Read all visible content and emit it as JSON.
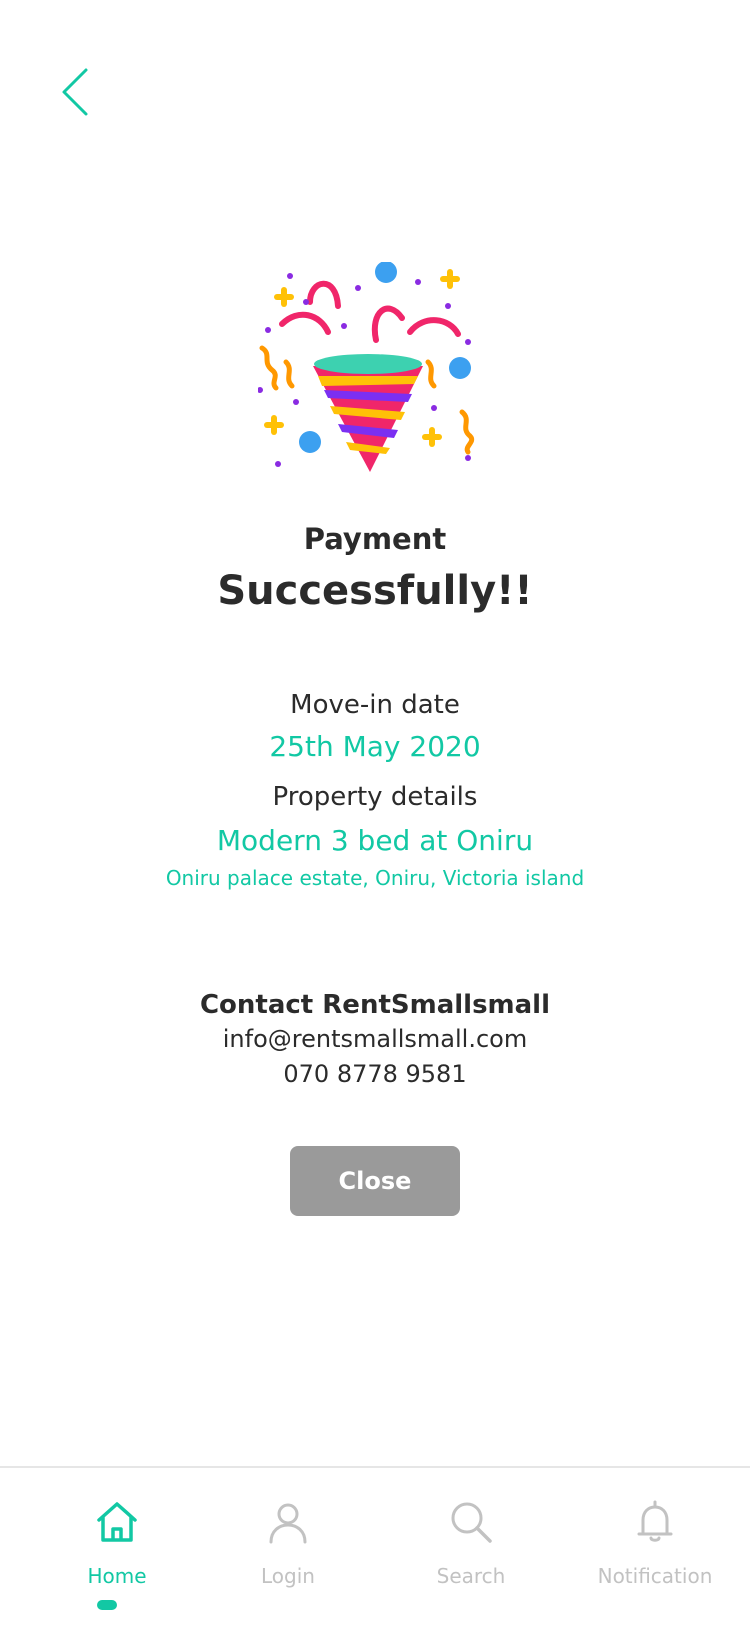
{
  "colors": {
    "accent": "#12c8a4",
    "text": "#2b2b2b",
    "button_bg": "#9a9a9a",
    "nav_inactive": "#c2c2c2"
  },
  "header": {
    "back_icon": "chevron-left-icon"
  },
  "illustration": {
    "icon": "party-popper-icon"
  },
  "status": {
    "line1": "Payment",
    "line2": "Successfully!!"
  },
  "move_in": {
    "label": "Move-in date",
    "value": "25th May 2020"
  },
  "property": {
    "label": "Property details",
    "name": "Modern 3 bed at Oniru",
    "address": "Oniru palace estate, Oniru, Victoria island"
  },
  "contact": {
    "title": "Contact RentSmallsmall",
    "email": "info@rentsmallsmall.com",
    "phone": "070 8778 9581"
  },
  "actions": {
    "close_label": "Close"
  },
  "bottom_nav": {
    "items": [
      {
        "label": "Home",
        "icon": "home-icon",
        "active": true
      },
      {
        "label": "Login",
        "icon": "user-icon",
        "active": false
      },
      {
        "label": "Search",
        "icon": "search-icon",
        "active": false
      },
      {
        "label": "Notification",
        "icon": "bell-icon",
        "active": false
      }
    ]
  }
}
